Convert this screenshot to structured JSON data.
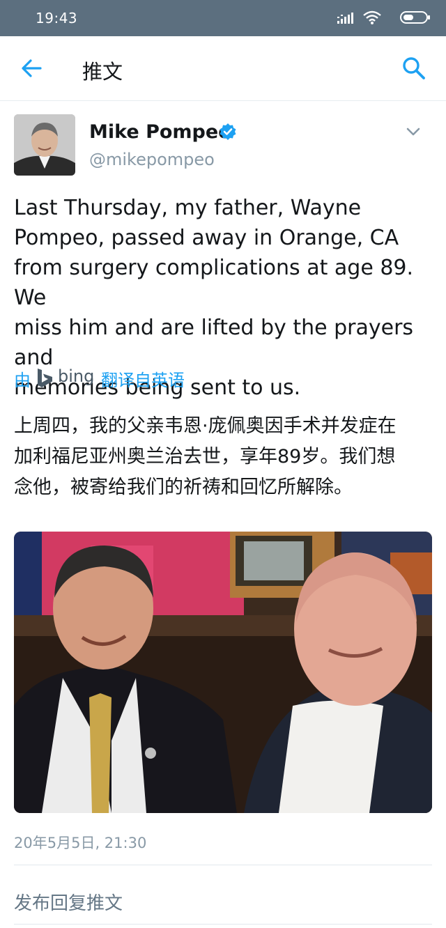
{
  "status_bar": {
    "time": "19:43",
    "icons": [
      "signal-icon",
      "wifi-icon",
      "battery-icon"
    ]
  },
  "nav": {
    "title": "推文",
    "back_icon": "back-arrow-icon",
    "search_icon": "search-icon"
  },
  "tweet": {
    "author_name": "Mike Pompeo",
    "author_handle": "@mikepompeo",
    "verified": true,
    "lines": [
      "Last Thursday, my father, Wayne",
      "Pompeo, passed away in Orange, CA",
      "from surgery complications at age 89. We",
      "miss him and are lifted by the prayers and",
      "memories being sent to us."
    ],
    "translation_prefix": "由",
    "translation_provider": "bing",
    "translation_suffix": "翻译自英语",
    "translation_lines": [
      "上周四，我的父亲韦恩·庞佩奥因手术并发症在",
      "加利福尼亚州奥兰治去世，享年89岁。我们想",
      "念他，被寄给我们的祈祷和回忆所解除。"
    ],
    "timestamp": "20年5月5日, 21:30",
    "reply_prompt": "发布回复推文"
  },
  "colors": {
    "status_bar": "#5c6f7f",
    "accent": "#1da1f2",
    "secondary_text": "#8899a6",
    "divider": "#e1e8ed"
  }
}
